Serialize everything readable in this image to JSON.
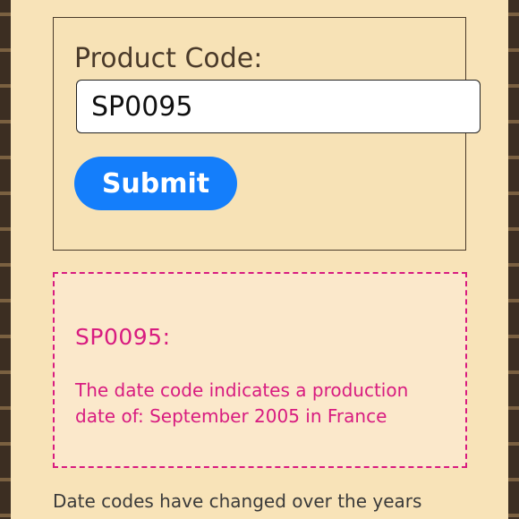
{
  "form": {
    "label": "Product Code:",
    "input_value": "SP0095",
    "submit_label": "Submit"
  },
  "result": {
    "title": "SP0095:",
    "text": "The date code indicates a production date of: September 2005 in France"
  },
  "footer": {
    "text": "Date codes have changed over the years"
  },
  "colors": {
    "page_background": "#f8e3b8",
    "accent_button": "#147efb",
    "result_text": "#d81b80",
    "border_pattern": "#3c2e22"
  }
}
